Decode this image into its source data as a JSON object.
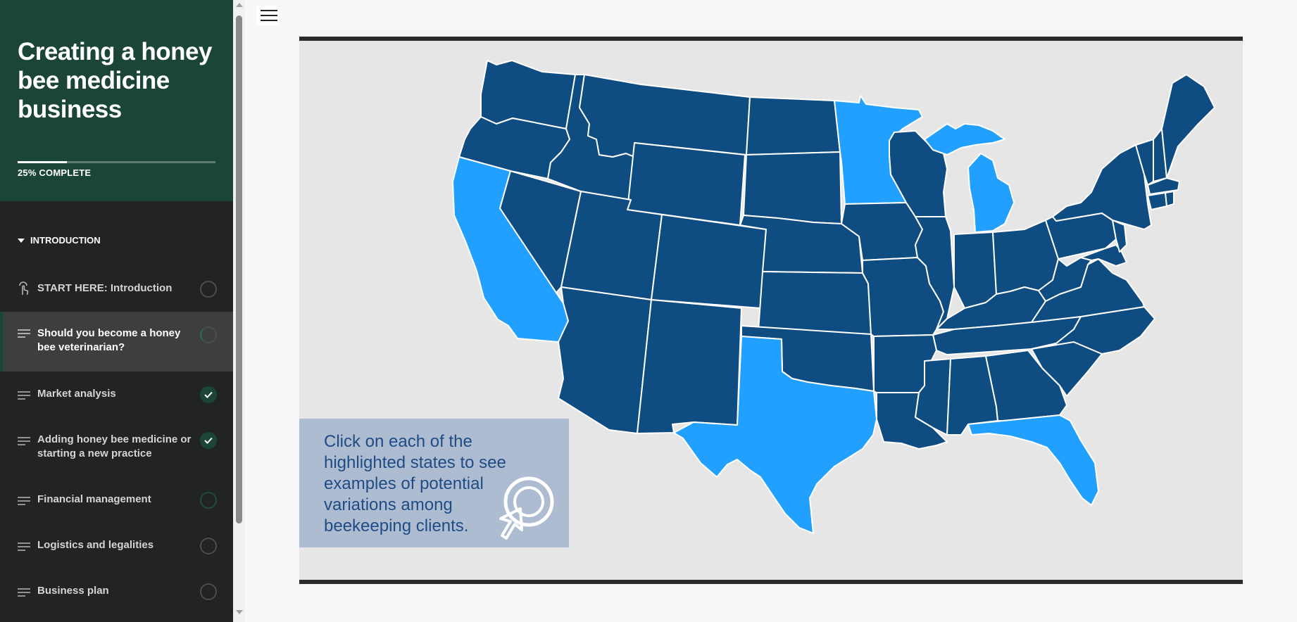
{
  "course": {
    "title": "Creating a honey bee medicine business",
    "progress_percent": 25,
    "progress_label": "25% COMPLETE"
  },
  "sidebar": {
    "section": {
      "label": "INTRODUCTION",
      "icon": "caret-down-icon"
    },
    "lessons": [
      {
        "title": "START HERE: Introduction",
        "icon": "touch-icon",
        "status": "not-started"
      },
      {
        "title": "Should you become a honey bee veterinarian?",
        "icon": "text-lines-icon",
        "status": "in-progress"
      },
      {
        "title": "Market analysis",
        "icon": "text-lines-icon",
        "status": "complete"
      },
      {
        "title": "Adding honey bee medicine or starting a new practice",
        "icon": "text-lines-icon",
        "status": "complete"
      },
      {
        "title": "Financial management",
        "icon": "text-lines-icon",
        "status": "started"
      },
      {
        "title": "Logistics and legalities",
        "icon": "text-lines-icon",
        "status": "not-started"
      },
      {
        "title": "Business plan",
        "icon": "text-lines-icon",
        "status": "not-started"
      }
    ]
  },
  "main": {
    "menu_icon": "hamburger-menu-icon",
    "map": {
      "colors": {
        "state": "#0f4c81",
        "highlighted": "#21a0ff",
        "background": "#e6e6e6",
        "border": "#ffffff"
      },
      "highlighted_states": [
        "California",
        "Texas",
        "Minnesota",
        "Michigan",
        "Florida"
      ]
    },
    "instruction": {
      "text": "Click on each of the highlighted states to see examples of potential variations among beekeeping clients.",
      "icon": "click-pointer-icon"
    }
  }
}
